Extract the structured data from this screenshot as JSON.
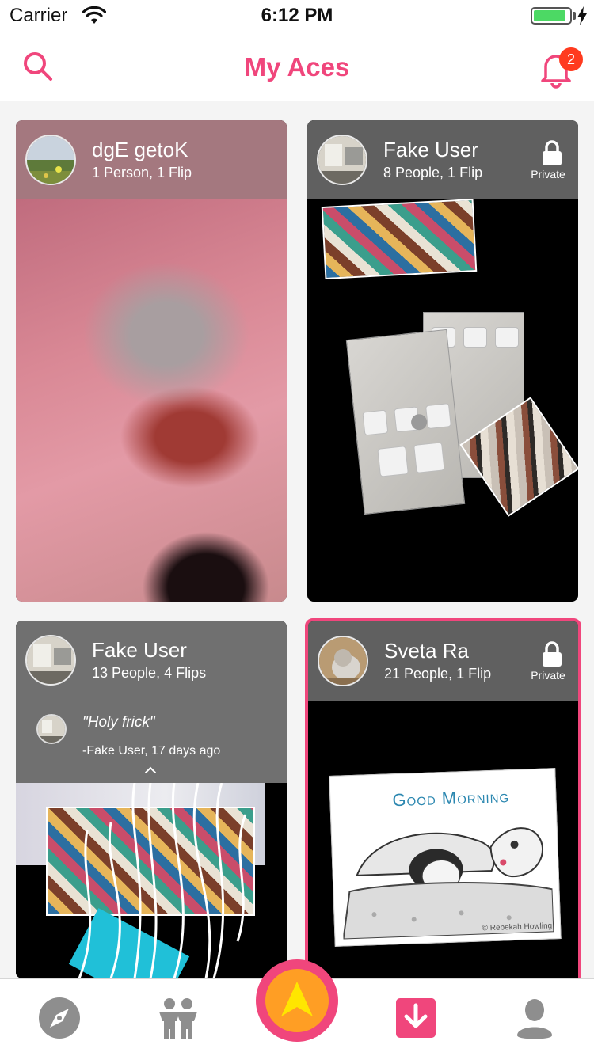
{
  "status_bar": {
    "carrier": "Carrier",
    "time": "6:12 PM",
    "battery_level": 0.9
  },
  "nav": {
    "title": "My Aces",
    "notification_count": "2"
  },
  "cards": [
    {
      "name": "dgE getoK",
      "meta": "1 Person, 1 Flip",
      "private": false
    },
    {
      "name": "Fake User",
      "meta": "8 People, 1 Flip",
      "private": true,
      "private_label": "Private"
    },
    {
      "name": "Fake User",
      "meta": "13 People, 4 Flips",
      "private": false,
      "comment": {
        "quote": "\"Holy frick\"",
        "author": "-Fake User, 17 days ago"
      }
    },
    {
      "name": "Sveta Ra",
      "meta": "21 People, 1 Flip",
      "private": true,
      "private_label": "Private",
      "selected": true,
      "image_caption": "Good Morning",
      "image_credit": "© Rebekah Howling"
    }
  ],
  "tab_bar": {
    "tabs": [
      "compass-icon",
      "people-icon",
      "create-icon",
      "download-icon",
      "profile-icon"
    ],
    "active": "download-icon"
  },
  "colors": {
    "accent": "#f0467c",
    "badge": "#ff3b1f",
    "create_inner": "#ff9e24",
    "create_arrow": "#ffe600"
  }
}
